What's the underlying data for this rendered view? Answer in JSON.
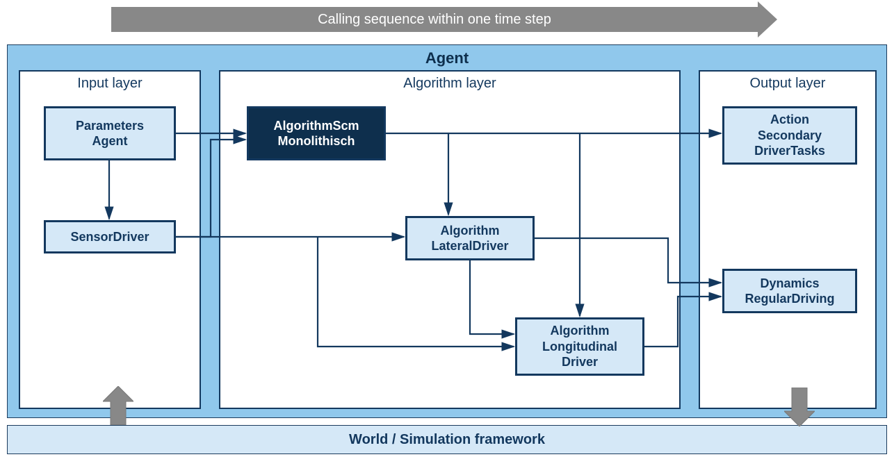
{
  "top_arrow_label": "Calling sequence within one time step",
  "agent_title": "Agent",
  "world_title": "World / Simulation framework",
  "layers": {
    "input": {
      "title": "Input layer"
    },
    "algorithm": {
      "title": "Algorithm layer"
    },
    "output": {
      "title": "Output layer"
    }
  },
  "boxes": {
    "params": "Parameters\nAgent",
    "sensor": "SensorDriver",
    "algo_scm": "AlgorithmScm\nMonolithisch",
    "algo_lat": "Algorithm\nLateralDriver",
    "algo_long": "Algorithm\nLongitudinal\nDriver",
    "action": "Action\nSecondary\nDriverTasks",
    "dynamics": "Dynamics\nRegularDriving"
  },
  "connections": [
    {
      "from": "params",
      "to": "sensor",
      "style": "vertical"
    },
    {
      "from": "params",
      "to": "algo_scm"
    },
    {
      "from": "sensor",
      "to": "algo_scm"
    },
    {
      "from": "sensor",
      "to": "algo_lat"
    },
    {
      "from": "sensor",
      "to": "algo_long"
    },
    {
      "from": "algo_scm",
      "to": "action"
    },
    {
      "from": "algo_scm",
      "to": "algo_lat",
      "style": "vertical"
    },
    {
      "from": "algo_scm",
      "to": "algo_long"
    },
    {
      "from": "algo_lat",
      "to": "algo_long"
    },
    {
      "from": "algo_lat",
      "to": "dynamics"
    },
    {
      "from": "algo_long",
      "to": "dynamics"
    }
  ],
  "big_arrows": [
    {
      "name": "world-to-input",
      "direction": "up"
    },
    {
      "name": "output-to-world",
      "direction": "down"
    }
  ],
  "colors": {
    "container_bg": "#90c8ec",
    "box_bg": "#d5e8f7",
    "box_dark_bg": "#0e2f4d",
    "border": "#13385e",
    "arrow_gray": "#888"
  }
}
